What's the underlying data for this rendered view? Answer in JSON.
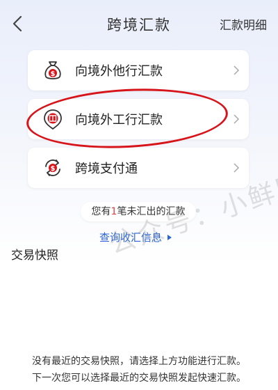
{
  "header": {
    "title": "跨境汇款",
    "detail_link": "汇款明细"
  },
  "menu": [
    {
      "label": "向境外他行汇款",
      "icon": "money-bag-icon"
    },
    {
      "label": "向境外工行汇款",
      "icon": "icbc-location-icon"
    },
    {
      "label": "跨境支付通",
      "icon": "exchange-icon"
    }
  ],
  "pending": {
    "prefix": "您有",
    "count": "1",
    "suffix": "笔未汇出的汇款"
  },
  "query_link": "查询收汇信息",
  "snapshot": {
    "title": "交易快照",
    "empty_line1": "没有最近的交易快照，请选择上方功能进行汇款。",
    "empty_line2": "下一次您可以选择最近的交易快照发起快速汇款。"
  },
  "watermark": "公众号：小鲜网",
  "colors": {
    "accent_red": "#d7141a",
    "link_blue": "#2c63d6"
  }
}
